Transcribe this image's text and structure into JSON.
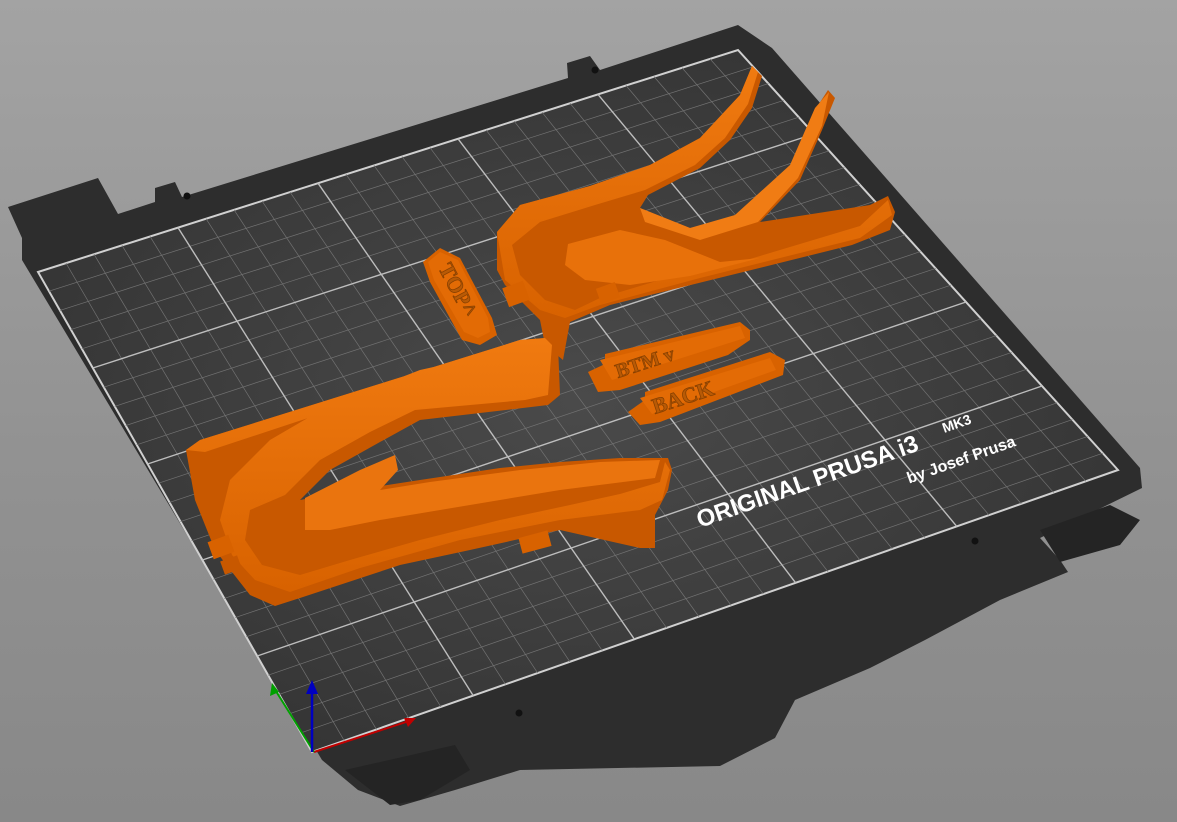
{
  "viewport": {
    "background_color": "#999999",
    "bed": {
      "frame_color": "#2d2d2d",
      "surface_color": "#363636",
      "grid_color": "#6e6e6e",
      "border_color": "#d0d0d0",
      "logo_line1": "ORIGINAL PRUSA i3",
      "logo_model": "MK3",
      "logo_line2": "by Josef Prusa"
    },
    "objects": {
      "color": "#e06a00",
      "labels": {
        "top": "TOP^",
        "btm": "BTM v",
        "back": "BACK"
      }
    },
    "axes": {
      "x_color": "#c00000",
      "y_color": "#00a000",
      "z_color": "#0000c0"
    }
  }
}
